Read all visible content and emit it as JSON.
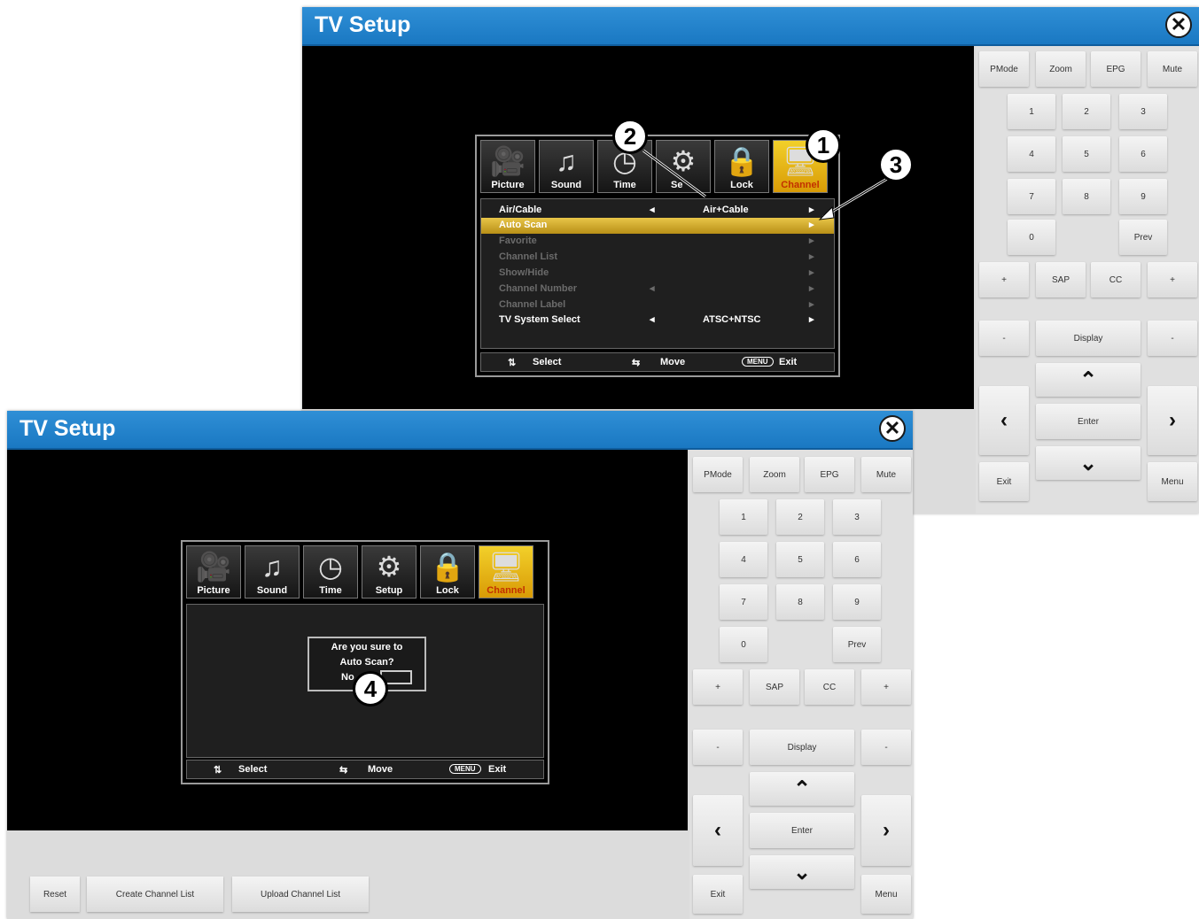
{
  "window1": {
    "title": "TV Setup",
    "close": "✕",
    "remote": {
      "row1": [
        "PMode",
        "Zoom",
        "EPG",
        "Mute"
      ],
      "digits": [
        "1",
        "2",
        "3",
        "4",
        "5",
        "6",
        "7",
        "8",
        "9",
        "0"
      ],
      "prev": "Prev",
      "row_sap": [
        "+",
        "SAP",
        "CC",
        "+"
      ],
      "left_minus": "-",
      "display": "Display",
      "right_minus": "-",
      "enter": "Enter",
      "exit": "Exit",
      "menu": "Menu"
    },
    "osd": {
      "icons": [
        "Picture",
        "Sound",
        "Time",
        "Setup",
        "Lock",
        "Channel"
      ],
      "setup_partial": "Se",
      "selected_tab": "Channel",
      "rows": [
        {
          "key": "Air/Cable",
          "value": "Air+Cable",
          "state": "normal"
        },
        {
          "key": "Auto Scan",
          "value": "",
          "state": "highlight"
        },
        {
          "key": "Favorite",
          "value": "",
          "state": "dim"
        },
        {
          "key": "Channel List",
          "value": "",
          "state": "dim"
        },
        {
          "key": "Show/Hide",
          "value": "",
          "state": "dim"
        },
        {
          "key": "Channel Number",
          "value": "",
          "state": "dim"
        },
        {
          "key": "Channel Label",
          "value": "",
          "state": "dim"
        },
        {
          "key": "TV System Select",
          "value": "ATSC+NTSC",
          "state": "normal"
        }
      ],
      "footer": {
        "select": "Select",
        "move": "Move",
        "menu_key": "MENU",
        "exit": "Exit"
      }
    },
    "callouts": [
      "1",
      "2",
      "3"
    ]
  },
  "window2": {
    "title": "TV Setup",
    "close": "✕",
    "remote": {
      "row1": [
        "PMode",
        "Zoom",
        "EPG",
        "Mute"
      ],
      "digits": [
        "1",
        "2",
        "3",
        "4",
        "5",
        "6",
        "7",
        "8",
        "9",
        "0"
      ],
      "prev": "Prev",
      "row_sap": [
        "+",
        "SAP",
        "CC",
        "+"
      ],
      "left_minus": "-",
      "display": "Display",
      "right_minus": "-",
      "enter": "Enter",
      "exit": "Exit",
      "menu": "Menu"
    },
    "osd": {
      "icons": [
        "Picture",
        "Sound",
        "Time",
        "Setup",
        "Lock",
        "Channel"
      ],
      "selected_tab": "Channel",
      "dialog_line1": "Are you sure to",
      "dialog_line2": "Auto Scan?",
      "dialog_no": "No",
      "footer": {
        "select": "Select",
        "move": "Move",
        "menu_key": "MENU",
        "exit": "Exit"
      }
    },
    "bottom_buttons": [
      "Reset",
      "Create Channel List",
      "Upload Channel List"
    ],
    "callouts": [
      "4"
    ]
  },
  "icon_names": {
    "close": "close-icon",
    "up": "chevron-up-icon",
    "down": "chevron-down-icon",
    "left": "chevron-left-icon",
    "right": "chevron-right-icon"
  },
  "colors": {
    "titlebar": "#1a78c2",
    "highlight": "#d9b030",
    "selected_tab": "#e8b514"
  }
}
